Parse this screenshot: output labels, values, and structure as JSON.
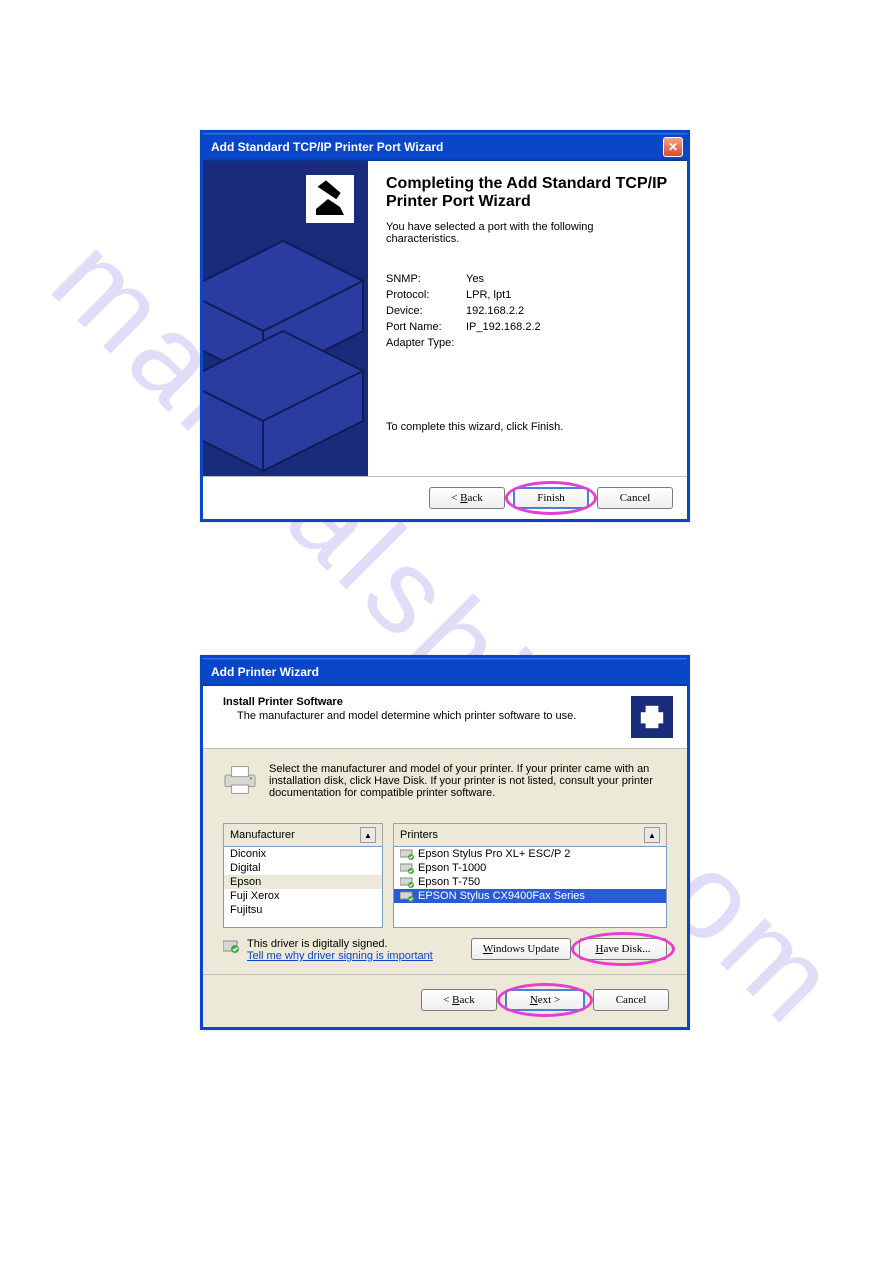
{
  "dialog1": {
    "title": "Add Standard TCP/IP Printer Port Wizard",
    "heading": "Completing the Add Standard TCP/IP Printer Port Wizard",
    "description": "You have selected a port with the following characteristics.",
    "rows": {
      "snmp_label": "SNMP:",
      "snmp_value": "Yes",
      "proto_label": "Protocol:",
      "proto_value": "LPR, lpt1",
      "device_label": "Device:",
      "device_value": "192.168.2.2",
      "port_label": "Port Name:",
      "port_value": "IP_192.168.2.2",
      "adapter_label": "Adapter Type:",
      "adapter_value": ""
    },
    "complete": "To complete this wizard, click Finish.",
    "buttons": {
      "back": "< Back",
      "finish": "Finish",
      "cancel": "Cancel"
    }
  },
  "dialog2": {
    "title": "Add Printer Wizard",
    "header_title": "Install Printer Software",
    "header_sub": "The manufacturer and model determine which printer software to use.",
    "instruction": "Select the manufacturer and model of your printer. If your printer came with an installation disk, click Have Disk. If your printer is not listed, consult your printer documentation for compatible printer software.",
    "manu_header": "Manufacturer",
    "printers_header": "Printers",
    "manufacturers": [
      "Diconix",
      "Digital",
      "Epson",
      "Fuji Xerox",
      "Fujitsu"
    ],
    "selected_manu_index": 2,
    "printers": [
      "Epson Stylus Pro XL+ ESC/P 2",
      "Epson T-1000",
      "Epson T-750",
      "EPSON Stylus CX9400Fax Series"
    ],
    "selected_printer_index": 3,
    "signed_text": "This driver is digitally signed.",
    "signed_link": "Tell me why driver signing is important",
    "win_update": "Windows Update",
    "have_disk": "Have Disk...",
    "buttons": {
      "back": "< Back",
      "next": "Next >",
      "cancel": "Cancel"
    }
  }
}
